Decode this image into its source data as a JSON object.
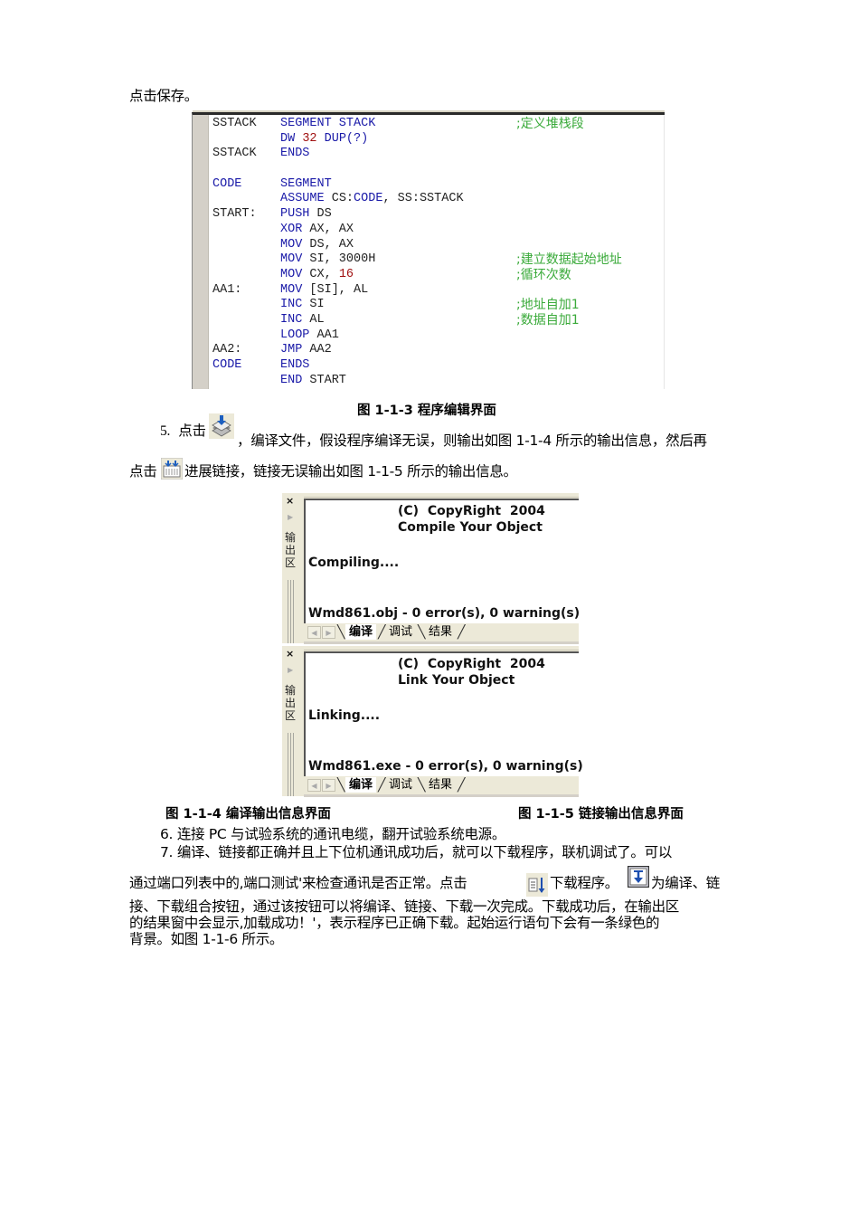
{
  "intro": "点击保存。",
  "editor": {
    "lines": [
      {
        "label": "SSTACK",
        "tokens": [
          {
            "t": "SEGMENT STACK",
            "c": "kw"
          }
        ],
        "comment": ";定义堆栈段"
      },
      {
        "label": "",
        "tokens": [
          {
            "t": "DW ",
            "c": "kw"
          },
          {
            "t": "32",
            "c": "num"
          },
          {
            "t": " DUP(?)",
            "c": "kw"
          }
        ],
        "comment": ""
      },
      {
        "label": "SSTACK",
        "tokens": [
          {
            "t": "ENDS",
            "c": "kw"
          }
        ],
        "comment": ""
      },
      {
        "label": "",
        "tokens": [],
        "comment": ""
      },
      {
        "label": "CODE",
        "labelColor": "kw",
        "tokens": [
          {
            "t": "SEGMENT",
            "c": "kw"
          }
        ],
        "comment": ""
      },
      {
        "label": "",
        "tokens": [
          {
            "t": "ASSUME ",
            "c": "kw"
          },
          {
            "t": "CS:",
            "c": "id"
          },
          {
            "t": "CODE",
            "c": "kw"
          },
          {
            "t": ", SS:SSTACK",
            "c": "id"
          }
        ],
        "comment": ""
      },
      {
        "label": "START:",
        "tokens": [
          {
            "t": "PUSH ",
            "c": "kw"
          },
          {
            "t": "DS",
            "c": "id"
          }
        ],
        "comment": ""
      },
      {
        "label": "",
        "tokens": [
          {
            "t": "XOR ",
            "c": "kw"
          },
          {
            "t": "AX, AX",
            "c": "id"
          }
        ],
        "comment": ""
      },
      {
        "label": "",
        "tokens": [
          {
            "t": "MOV ",
            "c": "kw"
          },
          {
            "t": "DS, AX",
            "c": "id"
          }
        ],
        "comment": ""
      },
      {
        "label": "",
        "tokens": [
          {
            "t": "MOV ",
            "c": "kw"
          },
          {
            "t": "SI, 3000H",
            "c": "id"
          }
        ],
        "comment": ";建立数据起始地址"
      },
      {
        "label": "",
        "tokens": [
          {
            "t": "MOV ",
            "c": "kw"
          },
          {
            "t": "CX, ",
            "c": "id"
          },
          {
            "t": "16",
            "c": "num"
          }
        ],
        "comment": ";循环次数"
      },
      {
        "label": "AA1:",
        "tokens": [
          {
            "t": "MOV ",
            "c": "kw"
          },
          {
            "t": "[SI], AL",
            "c": "id"
          }
        ],
        "comment": ""
      },
      {
        "label": "",
        "tokens": [
          {
            "t": "INC ",
            "c": "kw"
          },
          {
            "t": "SI",
            "c": "id"
          }
        ],
        "comment": ";地址自加1"
      },
      {
        "label": "",
        "tokens": [
          {
            "t": "INC ",
            "c": "kw"
          },
          {
            "t": "AL",
            "c": "id"
          }
        ],
        "comment": ";数据自加1"
      },
      {
        "label": "",
        "tokens": [
          {
            "t": "LOOP ",
            "c": "kw"
          },
          {
            "t": "AA1",
            "c": "id"
          }
        ],
        "comment": ""
      },
      {
        "label": "AA2:",
        "tokens": [
          {
            "t": "JMP ",
            "c": "kw"
          },
          {
            "t": "AA2",
            "c": "id"
          }
        ],
        "comment": ""
      },
      {
        "label": "CODE",
        "labelColor": "kw",
        "tokens": [
          {
            "t": "ENDS",
            "c": "kw"
          }
        ],
        "comment": ""
      },
      {
        "label": "",
        "tokens": [
          {
            "t": "END ",
            "c": "kw"
          },
          {
            "t": "START",
            "c": "id"
          }
        ],
        "comment": ""
      }
    ],
    "colors": {
      "keyword": "#1a1aa8",
      "number": "#a01010",
      "comment": "#3aaa3a",
      "gutter": "#d4d0c8"
    }
  },
  "fig113_caption": "图 1-1-3  程序编辑界面",
  "step5": {
    "num": "5.",
    "pre": "点击",
    "compile_icon": "compile-icon",
    "mid": "，编译文件，假设程序编译无误，则输出如图 1-1-4 所示的输出信息，然后再",
    "line2_pre": "点击",
    "link_icon": "link-icon",
    "line2_post": "进展链接，链接无误输出如图 1-1-5 所示的输出信息。"
  },
  "compile_output": {
    "close": "×",
    "panel_label": "输出区",
    "line1": "(C)  CopyRight  2004",
    "line2": "Compile Your Object",
    "line3": "Compiling....",
    "line4": "Wmd861.obj - 0 error(s), 0 warning(s)",
    "tabs": [
      "编译",
      "调试",
      "结果"
    ],
    "active_tab": 0
  },
  "link_output": {
    "close": "×",
    "panel_label": "输出区",
    "line1": "(C)  CopyRight  2004",
    "line2": "Link Your Object",
    "line3": "Linking....",
    "line4": "Wmd861.exe - 0 error(s), 0 warning(s)",
    "tabs": [
      "编译",
      "调试",
      "结果"
    ],
    "active_tab": 0
  },
  "fig114_caption": "图 1-1-4  编译输出信息界面",
  "fig115_caption": "图 1-1-5  链接输出信息界面",
  "step6": "6.  连接 PC 与试验系统的通讯电缆，翻开试验系统电源。",
  "step7": {
    "line1": "7.  编译、链接都正确并且上下位机通讯成功后，就可以下载程序，联机调试了。可以",
    "line2_pre": "通过端口列表中的,端口测试'来检查通讯是否正常。点击",
    "download_icon": "download-icon",
    "line2_mid": "下载程序。",
    "combo_icon": "compile-link-download-icon",
    "line2_post": "为编译、链",
    "line3": "接、下载组合按钮，通过该按钮可以将编译、链接、下载一次完成。下载成功后，在输出区",
    "line4": "的结果窗中会显示,加载成功！'，表示程序已正确下载。起始运行语句下会有一条绿色的",
    "line5": "背景。如图 1-1-6 所示。"
  }
}
